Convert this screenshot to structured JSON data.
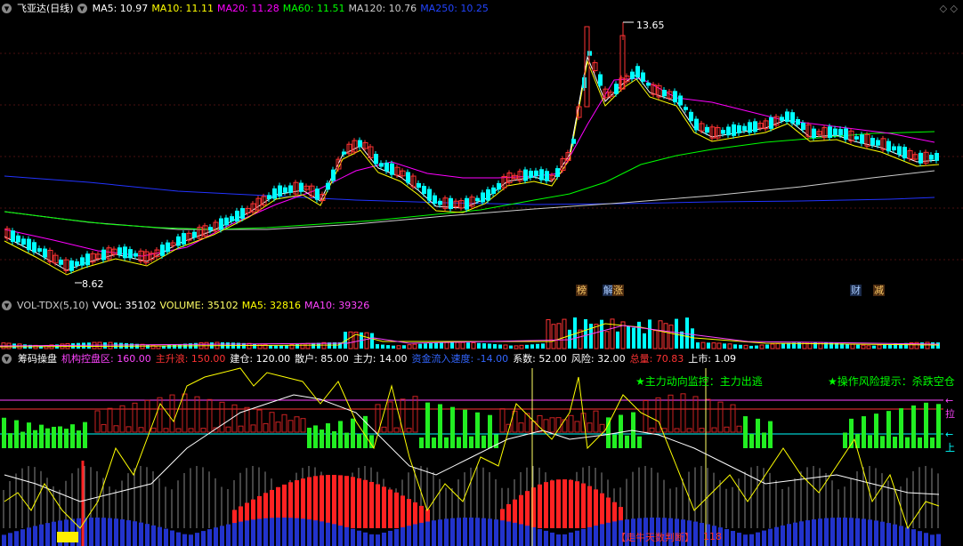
{
  "stock": {
    "name": "飞亚达(日线)"
  },
  "ma": [
    {
      "label": "MA5: 10.97",
      "color": "#ffffff"
    },
    {
      "label": "MA10: 11.11",
      "color": "#ffff00"
    },
    {
      "label": "MA20: 11.28",
      "color": "#ff00ff"
    },
    {
      "label": "MA60: 11.51",
      "color": "#00ff00"
    },
    {
      "label": "MA120: 10.76",
      "color": "#cccccc"
    },
    {
      "label": "MA250: 10.25",
      "color": "#2233ff"
    }
  ],
  "price": {
    "high_label": "13.65",
    "low_label": "8.62"
  },
  "event_tags": [
    "榜",
    "解",
    "涨",
    "财",
    "减"
  ],
  "vol": {
    "name": "VOL-TDX(5,10)",
    "vvol": "VVOL: 35102",
    "volume": "VOLUME: 35102",
    "ma5": "MA5: 32816",
    "ma10": "MA10: 39326"
  },
  "chip": {
    "name": "筹码操盘",
    "items": [
      {
        "label": "机构控盘区: 160.00",
        "color": "#ff44ff"
      },
      {
        "label": "主升浪: 150.00",
        "color": "#ff2222"
      },
      {
        "label": "建仓: 120.00",
        "color": "#ffffff"
      },
      {
        "label": "散户: 85.00",
        "color": "#ffffff"
      },
      {
        "label": "主力: 14.00",
        "color": "#ffffff"
      },
      {
        "label": "资金流入速度: -14.00",
        "color": "#3366ff"
      },
      {
        "label": "系数: 52.00",
        "color": "#ffffff"
      },
      {
        "label": "风险: 32.00",
        "color": "#ffffff"
      },
      {
        "label": "总量: 70.83",
        "color": "#ff2222"
      },
      {
        "label": "上市: 1.09",
        "color": "#ffffff"
      }
    ],
    "signal_main": "★主力动向监控：主力出逃",
    "signal_risk": "★操作风险提示：杀跌空仓",
    "bottom_label": "【走牛天数判断】",
    "bottom_value": "118",
    "side_labels": [
      "←拉",
      "←上"
    ]
  }
}
